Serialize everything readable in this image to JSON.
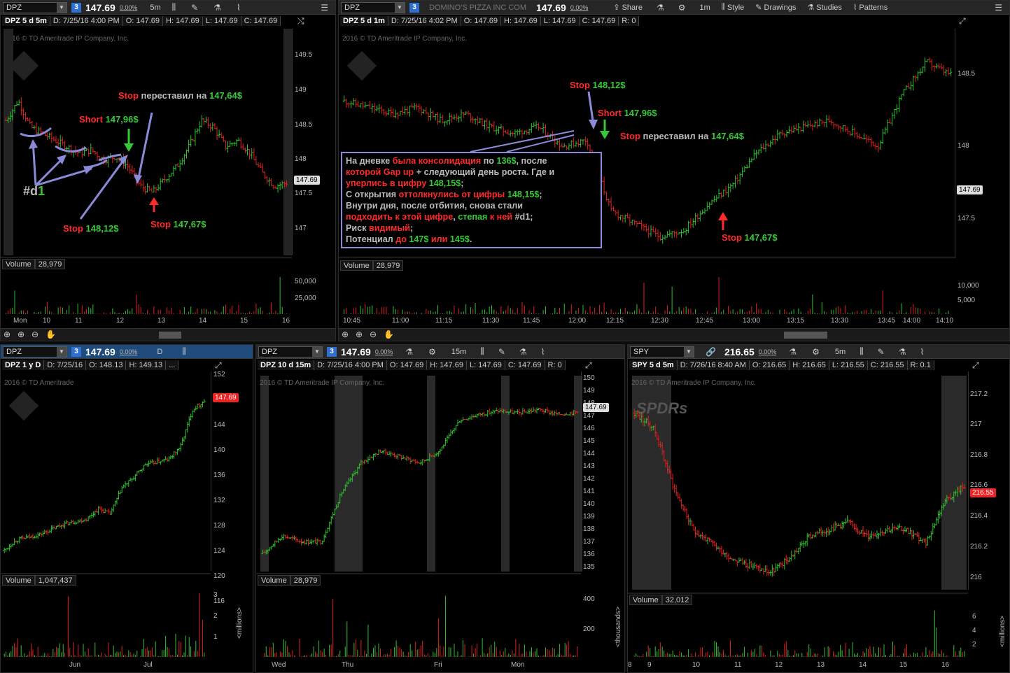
{
  "colors": {
    "up": "#2ec12e",
    "down": "#e02020",
    "bg": "#000000",
    "annotation": "#8a8ad8"
  },
  "top_left": {
    "symbol": "DPZ",
    "link": "3",
    "price": "147.69",
    "change": "0.00%",
    "timeframe": "5m",
    "header": [
      "DPZ 5 d 5m",
      "D: 7/25/16 4:00 PM",
      "O: 147.69",
      "H: 147.69",
      "L: 147.69",
      "C: 147.69"
    ],
    "copyright": "2016 © TD Ameritrade IP Company, Inc.",
    "price_tag": "147.69",
    "y_ticks": [
      "149.5",
      "149",
      "148.5",
      "148",
      "147.5",
      "147"
    ],
    "volume_label": "Volume",
    "volume_value": "28,979",
    "vol_ticks": [
      "50,000",
      "25,000"
    ],
    "x_ticks": [
      "Mon",
      "10",
      "11",
      "12",
      "13",
      "14",
      "15",
      "16"
    ],
    "annotations": {
      "stop_moved_red": "Stop",
      "stop_moved_text": " переставил на ",
      "stop_moved_val": "147,64$",
      "short_red": "Short",
      "short_val": " 147,96$",
      "stop1_red": "Stop",
      "stop1_val": " 148,12$",
      "stop2_red": "Stop",
      "stop2_val": " 147,67$",
      "d1_a": "#d",
      "d1_b": "1"
    }
  },
  "top_right": {
    "symbol": "DPZ",
    "link": "3",
    "company": "DOMINO'S PIZZA INC COM",
    "price": "147.69",
    "change": "0.00%",
    "menu": [
      "Share",
      "1m",
      "Style",
      "Drawings",
      "Studies",
      "Patterns"
    ],
    "header": [
      "DPZ 5 d 1m",
      "D: 7/25/16 4:02 PM",
      "O: 147.69",
      "H: 147.69",
      "L: 147.69",
      "C: 147.69",
      "R: 0"
    ],
    "copyright": "2016 © TD Ameritrade IP Company, Inc.",
    "price_tag": "147.69",
    "y_ticks": [
      "148.5",
      "148",
      "147.5"
    ],
    "volume_label": "Volume",
    "volume_value": "28,979",
    "vol_ticks": [
      "10,000",
      "5,000"
    ],
    "x_ticks": [
      "10:45",
      "11:00",
      "11:15",
      "11:30",
      "11:45",
      "12:00",
      "12:15",
      "12:30",
      "12:45",
      "13:00",
      "13:15",
      "13:30",
      "13:45",
      "14:00",
      "14:10"
    ],
    "annotations": {
      "stop1_red": "Stop",
      "stop1_val": " 148,12$",
      "short_red": "Short",
      "short_val": " 147,96$",
      "stop_moved_red": "Stop",
      "stop_moved_text": " переставил на ",
      "stop_moved_val": "147,64$",
      "stop2_red": "Stop",
      "stop2_val": " 147,67$"
    },
    "note": [
      [
        [
          "gry",
          "На дневке "
        ],
        [
          "red",
          "была консолидация"
        ],
        [
          "gry",
          " по "
        ],
        [
          "grn",
          "136$"
        ],
        [
          "gry",
          ", после"
        ]
      ],
      [
        [
          "red",
          "которой Gap up"
        ],
        [
          "gry",
          " + следующий день роста. Где и"
        ]
      ],
      [
        [
          "red",
          "уперлись в цифру"
        ],
        [
          "grn",
          " 148,15$"
        ],
        [
          "gry",
          ";"
        ]
      ],
      [
        [
          "gry",
          "С открытия "
        ],
        [
          "red",
          "оттолкнулись от цифры"
        ],
        [
          "grn",
          " 148,15$"
        ],
        [
          "gry",
          ";"
        ]
      ],
      [
        [
          "gry",
          "Внутри дня, после отбития, снова стали"
        ]
      ],
      [
        [
          "red",
          "подходить к этой цифре"
        ],
        [
          "gry",
          ", "
        ],
        [
          "grn",
          "степая"
        ],
        [
          "red",
          " к ней "
        ],
        [
          "gry",
          "#d1;"
        ]
      ],
      [
        [
          "gry",
          "Риск "
        ],
        [
          "red",
          "видимый"
        ],
        [
          "gry",
          ";"
        ]
      ],
      [
        [
          "gry",
          "Потенциал "
        ],
        [
          "red",
          "до "
        ],
        [
          "grn",
          "147$"
        ],
        [
          "red",
          " или "
        ],
        [
          "grn",
          "145$"
        ],
        [
          "gry",
          "."
        ]
      ]
    ]
  },
  "bottom_left": {
    "symbol": "DPZ",
    "link": "3",
    "price": "147.69",
    "change": "0.00%",
    "timeframe": "D",
    "header": [
      "DPZ 1 y D",
      "D: 7/25/16",
      "O: 148.13",
      "H: 149.13",
      "..."
    ],
    "copyright": "2016 © TD Ameritrade",
    "price_tag": "147.69",
    "y_ticks": [
      "152",
      "148",
      "144",
      "140",
      "136",
      "132",
      "128",
      "124",
      "120",
      "116"
    ],
    "volume_label": "Volume",
    "volume_value": "1,047,437",
    "vol_ticks": [
      "3",
      "2",
      "1"
    ],
    "vol_unit": "<millions>",
    "x_ticks": [
      "Jun",
      "Jul"
    ]
  },
  "bottom_mid": {
    "symbol": "DPZ",
    "link": "3",
    "price": "147.69",
    "change": "0.00%",
    "timeframe": "15m",
    "header": [
      "DPZ 10 d 15m",
      "D: 7/25/16 4:00 PM",
      "O: 147.69",
      "H: 147.69",
      "L: 147.69",
      "C: 147.69",
      "R: 0"
    ],
    "copyright": "2016 © TD Ameritrade IP Company, Inc.",
    "price_tag": "147.69",
    "y_ticks": [
      "150",
      "149",
      "148",
      "147",
      "146",
      "145",
      "144",
      "143",
      "142",
      "141",
      "140",
      "139",
      "138",
      "137",
      "136",
      "135"
    ],
    "volume_label": "Volume",
    "volume_value": "28,979",
    "vol_ticks": [
      "400",
      "200"
    ],
    "vol_unit": "<thousands>",
    "x_ticks": [
      "Wed",
      "Thu",
      "Fri",
      "Mon"
    ]
  },
  "bottom_right": {
    "symbol": "SPY",
    "link": "",
    "price": "216.65",
    "change": "0.00%",
    "timeframe": "5m",
    "header": [
      "SPY 5 d 5m",
      "D: 7/26/16 8:40 AM",
      "O: 216.65",
      "H: 216.65",
      "L: 216.55",
      "C: 216.55",
      "R: 0.1"
    ],
    "copyright": "2016 © TD Ameritrade IP Company, Inc.",
    "watermark": "SPDRs",
    "price_tag": "216.55",
    "y_ticks": [
      "217.2",
      "217",
      "216.8",
      "216.6",
      "216.4",
      "216.2",
      "216"
    ],
    "volume_label": "Volume",
    "volume_value": "32,012",
    "vol_ticks": [
      "6",
      "4",
      "2"
    ],
    "vol_unit": "<millions>",
    "x_ticks": [
      "8",
      "9",
      "10",
      "11",
      "12",
      "13",
      "14",
      "15",
      "16"
    ]
  },
  "chart_data": [
    {
      "type": "candlestick",
      "symbol": "DPZ",
      "period": "5 d 5m",
      "ylim": [
        146.8,
        149.7
      ],
      "close_path": [
        148.6,
        148.9,
        148.5,
        148.4,
        148.3,
        148.2,
        148.1,
        148.15,
        148.0,
        148.05,
        147.9,
        147.6,
        147.5,
        147.7,
        147.9,
        148.2,
        148.6,
        148.5,
        148.2,
        148.3,
        148.1,
        147.8,
        147.6,
        147.65
      ]
    },
    {
      "type": "candlestick",
      "symbol": "DPZ",
      "period": "5 d 1m",
      "ylim": [
        147.2,
        148.8
      ],
      "close_path": [
        148.35,
        148.3,
        148.25,
        148.3,
        148.2,
        148.25,
        148.15,
        148.1,
        148.15,
        148.0,
        148.05,
        147.5,
        147.4,
        147.3,
        147.35,
        147.55,
        147.7,
        147.95,
        148.1,
        148.15,
        148.2,
        148.1,
        148.0,
        148.4,
        148.65,
        148.55
      ]
    },
    {
      "type": "candlestick",
      "symbol": "DPZ",
      "period": "1 y D",
      "ylim": [
        116,
        152
      ],
      "close_path": [
        119,
        121,
        121.5,
        122,
        123,
        124,
        124.5,
        125,
        127,
        126,
        131,
        133,
        135.5,
        136,
        136.5,
        139,
        146,
        147.7
      ]
    },
    {
      "type": "candlestick",
      "symbol": "DPZ",
      "period": "10 d 15m",
      "ylim": [
        135,
        150
      ],
      "close_path": [
        136,
        137.5,
        137,
        137,
        141,
        143.5,
        144.5,
        144,
        143.5,
        144.5,
        147,
        147.5,
        147.8,
        147.6,
        147.9,
        147.5,
        147.7
      ]
    },
    {
      "type": "candlestick",
      "symbol": "SPY",
      "period": "5 d 5m",
      "ylim": [
        215.95,
        217.3
      ],
      "close_path": [
        217.1,
        217.0,
        216.6,
        216.3,
        216.2,
        216.1,
        216.05,
        216.0,
        216.1,
        216.25,
        216.3,
        216.35,
        216.25,
        216.3,
        216.3,
        216.2,
        216.5,
        216.6
      ]
    }
  ]
}
